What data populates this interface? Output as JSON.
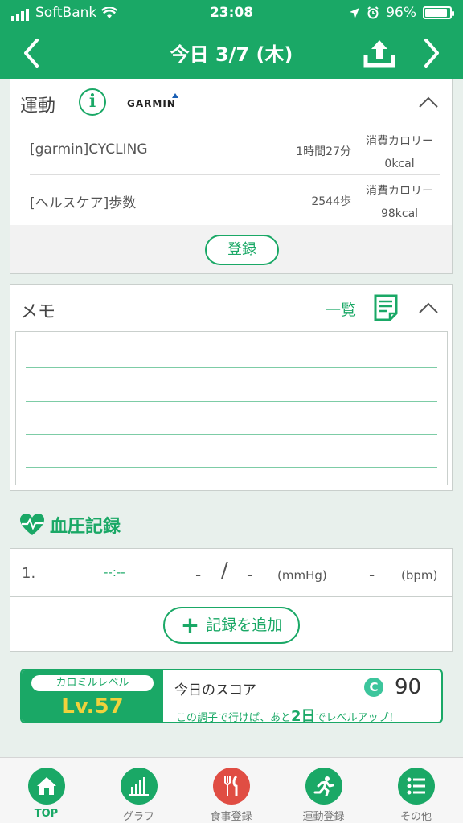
{
  "status": {
    "carrier": "SoftBank",
    "time": "23:08",
    "battery": "96%"
  },
  "nav": {
    "title": "今日 3/7 (木)"
  },
  "exercise": {
    "label": "運動",
    "brand": "GARMIN",
    "rows": [
      {
        "name": "[garmin]CYCLING",
        "amount": "1時間27分",
        "cal_label": "消費カロリー",
        "cal_value": "0kcal"
      },
      {
        "name": "[ヘルスケア]歩数",
        "amount": "2544歩",
        "cal_label": "消費カロリー",
        "cal_value": "98kcal"
      }
    ],
    "register_label": "登録"
  },
  "memo": {
    "label": "メモ",
    "list_label": "一覧"
  },
  "bp": {
    "title": "血圧記録",
    "row": {
      "index": "1.",
      "time": "--:--",
      "systolic": "-",
      "slash": "/",
      "diastolic": "-",
      "unit": "(mmHg)",
      "pulse": "-",
      "pulse_unit": "(bpm)"
    },
    "add_label": "記録を追加"
  },
  "score": {
    "level_label": "カロミルレベル",
    "level_value": "Lv.57",
    "today_label": "今日のスコア",
    "score_icon": "C",
    "score_value": "90",
    "msg_pre": "この調子で行けば、あと",
    "msg_days": "2日",
    "msg_post": "でレベルアップ！"
  },
  "tabs": [
    {
      "label": "TOP",
      "icon": "home-icon",
      "active": true
    },
    {
      "label": "グラフ",
      "icon": "bar-chart-icon",
      "active": false
    },
    {
      "label": "食事登録",
      "icon": "fork-knife-icon",
      "active": false
    },
    {
      "label": "運動登録",
      "icon": "running-icon",
      "active": false
    },
    {
      "label": "その他",
      "icon": "list-icon",
      "active": false
    }
  ],
  "colors": {
    "brand_green": "#1aa866",
    "level_yellow": "#f0d23c",
    "meal_red": "#e04d43"
  }
}
